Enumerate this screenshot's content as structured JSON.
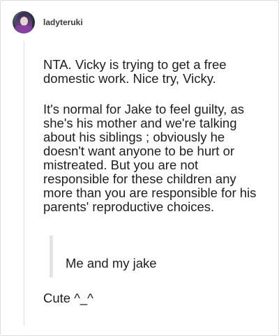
{
  "post": {
    "username": "ladyteruki",
    "paragraphs": [
      "NTA. Vicky is trying to get a free domestic work. Nice try, Vicky.",
      "It's normal for Jake to feel guilty, as she's his mother and we're talking about his siblings ; obviously he doesn't want anyone to be hurt or mistreated. But you are not responsible for these children any more than you are responsible for his parents' reproductive choices."
    ],
    "quote": "Me and my jake",
    "reply": "Cute ^_^"
  }
}
